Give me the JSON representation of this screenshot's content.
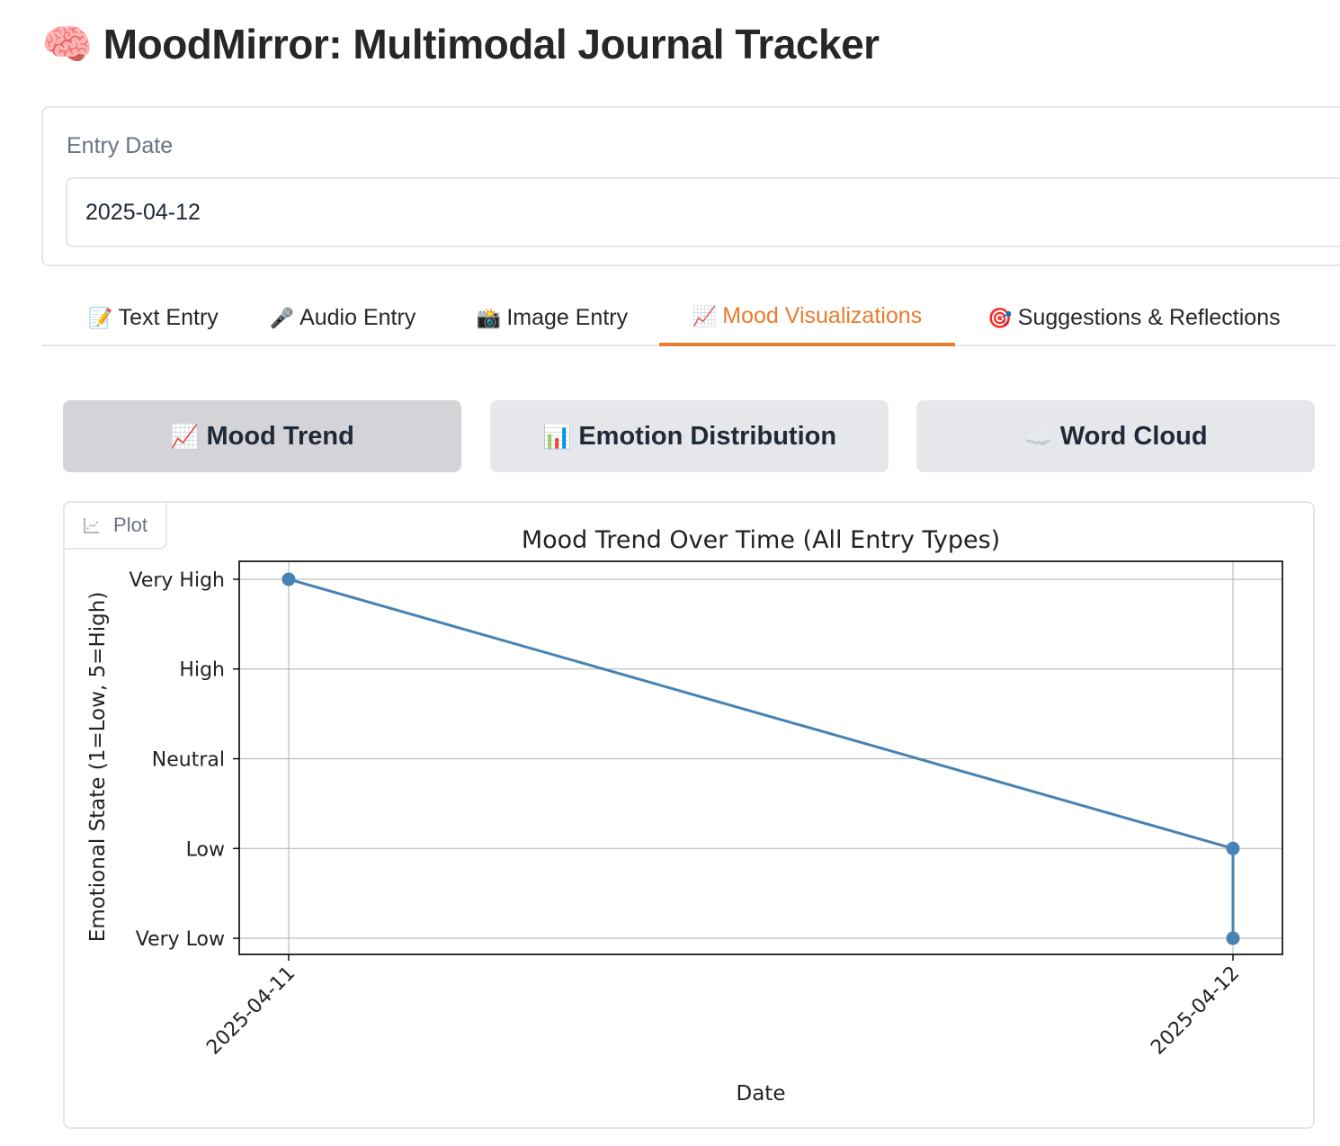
{
  "app": {
    "title_emoji": "🧠",
    "title": "MoodMirror: Multimodal Journal Tracker"
  },
  "date_field": {
    "label": "Entry Date",
    "value": "2025-04-12"
  },
  "tabs": [
    {
      "icon": "📝",
      "label": "Text Entry",
      "selected": false
    },
    {
      "icon": "🎤",
      "label": "Audio Entry",
      "selected": false
    },
    {
      "icon": "📸",
      "label": "Image Entry",
      "selected": false
    },
    {
      "icon": "📈",
      "label": "Mood Visualizations",
      "selected": true
    },
    {
      "icon": "🎯",
      "label": "Suggestions & Reflections",
      "selected": false
    }
  ],
  "viz_buttons": [
    {
      "icon": "📈",
      "label": "Mood Trend",
      "active": true
    },
    {
      "icon": "📊",
      "label": "Emotion Distribution",
      "active": false
    },
    {
      "icon": "☁️",
      "label": "Word Cloud",
      "active": false
    }
  ],
  "plot_panel": {
    "label": "Plot"
  },
  "colors": {
    "accent": "#ea7c2c",
    "line": "#4682b4"
  },
  "chart_data": {
    "type": "line",
    "title": "Mood Trend Over Time (All Entry Types)",
    "xlabel": "Date",
    "ylabel": "Emotional State (1=Low, 5=High)",
    "x_ticks": [
      "2025-04-11",
      "2025-04-12"
    ],
    "y_ticks": [
      {
        "value": 1,
        "label": "Very Low"
      },
      {
        "value": 2,
        "label": "Low"
      },
      {
        "value": 3,
        "label": "Neutral"
      },
      {
        "value": 4,
        "label": "High"
      },
      {
        "value": 5,
        "label": "Very High"
      }
    ],
    "ylim": [
      0.82,
      5.2
    ],
    "x": [
      "2025-04-11",
      "2025-04-12",
      "2025-04-12"
    ],
    "y": [
      5,
      2,
      1
    ],
    "grid": true,
    "marker": "circle"
  }
}
